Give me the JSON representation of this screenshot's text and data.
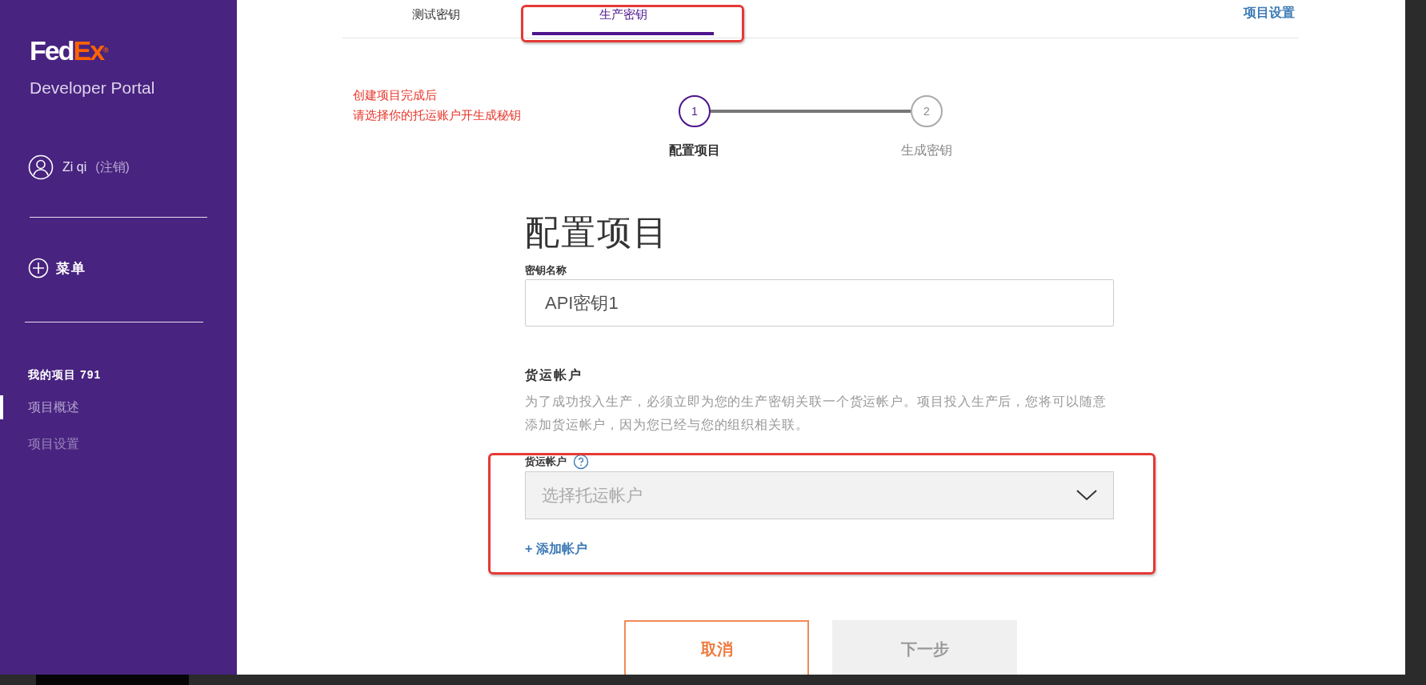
{
  "sidebar": {
    "logo": {
      "part_1": "Fed",
      "part_2": "Ex",
      "mark": "®"
    },
    "subtitle": "Developer Portal",
    "user": {
      "name": "Zi qi",
      "logout": "(注销)"
    },
    "menu": "菜单",
    "project_title": "我的项目 791",
    "items": [
      {
        "label": "项目概述",
        "selected": true
      },
      {
        "label": "项目设置",
        "selected": false
      }
    ]
  },
  "tabs": [
    {
      "label": "测试密钥",
      "selected": false
    },
    {
      "label": "生产密钥",
      "selected": true
    }
  ],
  "settings_link": "项目设置",
  "annotation": [
    "创建项目完成后",
    "请选择你的托运账户开生成秘钥"
  ],
  "steps": [
    {
      "number": "1",
      "label": "配置项目",
      "selected": true
    },
    {
      "number": "2",
      "label": "生成密钥",
      "selected": false
    }
  ],
  "form": {
    "title": "配置项目",
    "key_name": {
      "label": "密钥名称",
      "value": "API密钥1"
    },
    "section_title": "货运帐户",
    "description": "为了成功投入生产，必须立即为您的生产密钥关联一个货运帐户。项目投入生产后，您将可以随意添加货运帐户，因为您已经与您的组织相关联。",
    "account": {
      "label": "货运帐户",
      "placeholder": "选择托运帐户"
    },
    "add_account": "+ 添加帐户"
  },
  "buttons": [
    {
      "label": "取消",
      "kind": "secondary",
      "disabled": false
    },
    {
      "label": "下一步",
      "kind": "primary",
      "disabled": true
    }
  ]
}
